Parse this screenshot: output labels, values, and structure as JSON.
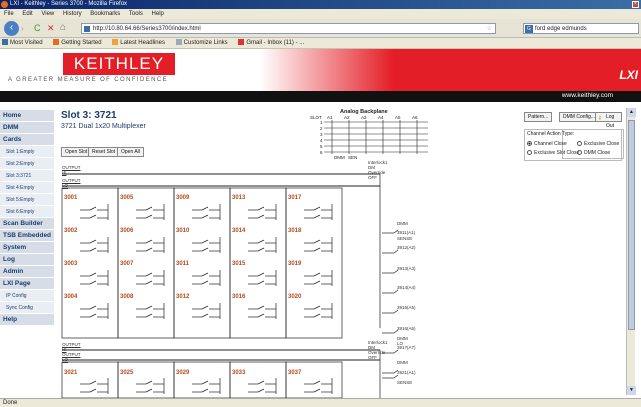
{
  "browser": {
    "window_title": "LXI - Keithley - Series 3700 - Mozilla Firefox",
    "menu": [
      "File",
      "Edit",
      "View",
      "History",
      "Bookmarks",
      "Tools",
      "Help"
    ],
    "url": "http://10.80.64.66/Series3700/index.html",
    "search_value": "ford edge edmunds",
    "bookmarks": [
      "Most Visited",
      "Getting Started",
      "Latest Headlines",
      "Customize Links",
      "Gmail - Inbox (11) - ..."
    ],
    "status": "Done"
  },
  "header": {
    "logo": "KEITHLEY",
    "tagline": "A GREATER MEASURE OF CONFIDENCE",
    "website": "www.keithley.com",
    "lxi": "LXI"
  },
  "sidebar": [
    {
      "label": "Home",
      "type": "main"
    },
    {
      "label": "DMM",
      "type": "main"
    },
    {
      "label": "Cards",
      "type": "main"
    },
    {
      "label": "Slot 1:Empty",
      "type": "sub"
    },
    {
      "label": "Slot 2:Empty",
      "type": "sub"
    },
    {
      "label": "Slot 3:3721",
      "type": "sub"
    },
    {
      "label": "Slot 4:Empty",
      "type": "sub"
    },
    {
      "label": "Slot 5:Empty",
      "type": "sub"
    },
    {
      "label": "Slot 6:Empty",
      "type": "sub"
    },
    {
      "label": "Scan Builder",
      "type": "main"
    },
    {
      "label": "TSB Embedded",
      "type": "main"
    },
    {
      "label": "System",
      "type": "main"
    },
    {
      "label": "Log",
      "type": "main"
    },
    {
      "label": "Admin",
      "type": "main"
    },
    {
      "label": "LXI Page",
      "type": "main"
    },
    {
      "label": "IP Config",
      "type": "sub"
    },
    {
      "label": "Sync Config",
      "type": "sub"
    },
    {
      "label": "Help",
      "type": "main"
    }
  ],
  "main": {
    "slot_title": "Slot 3: 3721",
    "slot_subtitle": "3721 Dual 1x20 Multiplexer",
    "buttons": {
      "open_slot": "Open Slot",
      "reset_slot": "Reset Slot",
      "open_all": "Open All",
      "pattern": "Pattern...",
      "dmm_config": "DMM Config...",
      "log_out": "Log Out"
    },
    "backplane": {
      "title": "Analog Backplane",
      "slot_label": "SLOT",
      "columns": [
        "A1",
        "A2",
        "A3",
        "A4",
        "A5",
        "A6"
      ],
      "rows": [
        "1",
        "2",
        "3",
        "4",
        "5",
        "6"
      ],
      "footer": [
        "DMM",
        "SEN"
      ]
    },
    "channel_action": {
      "title": "Channel Action Type:",
      "options": [
        "Channel Close",
        "Exclusive Close",
        "Exclusive Slot Close",
        "DMM Close"
      ],
      "selected": "Channel Close"
    },
    "output_hi": "OUTPUT HI",
    "output_lo": "OUTPUT LO",
    "interlock": "Interlock1 DM\nOverride OFF",
    "bank1_channels": [
      [
        "3001",
        "3005",
        "3009",
        "3013",
        "3017"
      ],
      [
        "3002",
        "3006",
        "3010",
        "3014",
        "3018"
      ],
      [
        "3003",
        "3007",
        "3011",
        "3015",
        "3019"
      ],
      [
        "3004",
        "3008",
        "3012",
        "3016",
        "3020"
      ]
    ],
    "bank1_right": [
      "DMM",
      "3911(A1)",
      "SENSE",
      "3912(A2)",
      "3913(A3)",
      "3914(A4)",
      "3915(A5)",
      "3916(A6)",
      "DMM LO",
      "3917(A7)"
    ],
    "bank2_channels": [
      "3021",
      "3025",
      "3029",
      "3033",
      "3037"
    ],
    "bank2_right": [
      "DMM",
      "3921(A1)",
      "SENSE"
    ]
  }
}
